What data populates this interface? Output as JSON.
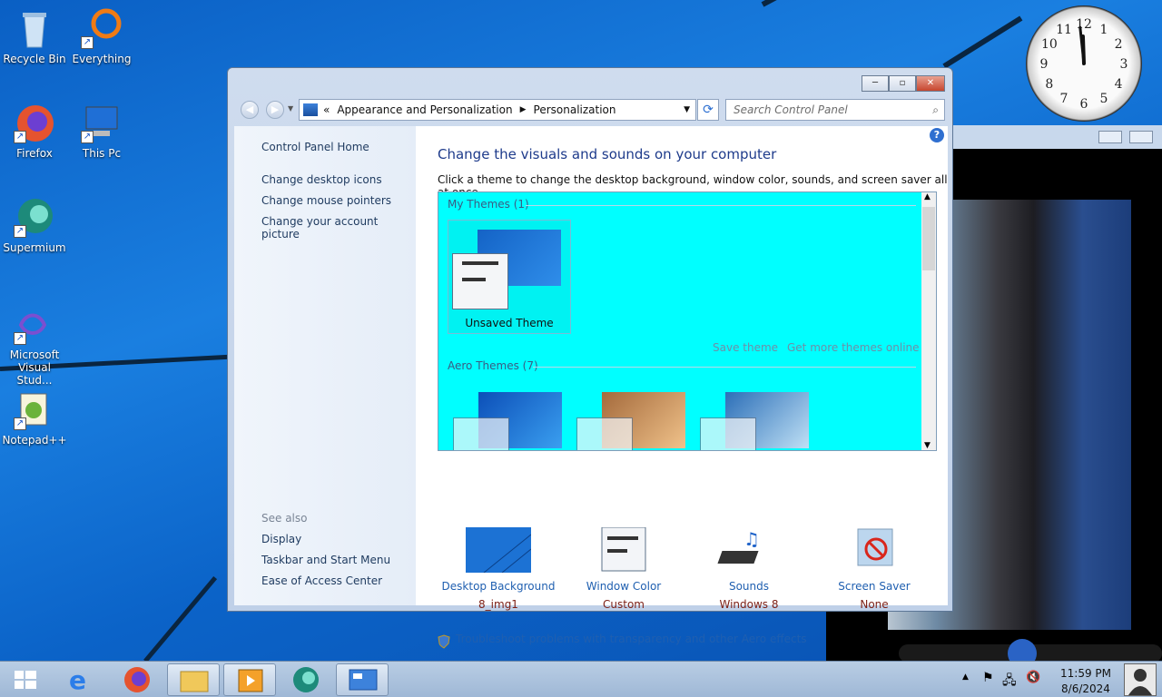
{
  "desktop": {
    "icons": [
      {
        "label": "Recycle Bin",
        "icon": "recycle-bin-icon"
      },
      {
        "label": "Everything",
        "icon": "everything-search-icon"
      },
      {
        "label": "Firefox",
        "icon": "firefox-icon"
      },
      {
        "label": "This Pc",
        "icon": "computer-icon"
      },
      {
        "label": "Supermium",
        "icon": "supermium-icon"
      },
      {
        "label": "Microsoft Visual Stud...",
        "icon": "visual-studio-icon"
      },
      {
        "label": "Notepad++",
        "icon": "notepad-plus-plus-icon"
      }
    ]
  },
  "clock": {
    "numbers": [
      "12",
      "1",
      "2",
      "3",
      "4",
      "5",
      "6",
      "7",
      "8",
      "9",
      "10",
      "11"
    ]
  },
  "window": {
    "address": {
      "root": "Appearance and Personalization",
      "current": "Personalization"
    },
    "search_placeholder": "Search Control Panel",
    "left_pane": {
      "home": "Control Panel Home",
      "links": [
        "Change desktop icons",
        "Change mouse pointers",
        "Change your account picture"
      ],
      "see_also": "See also",
      "see_also_links": [
        "Display",
        "Taskbar and Start Menu",
        "Ease of Access Center"
      ]
    },
    "title": "Change the visuals and sounds on your computer",
    "subtitle": "Click a theme to change the desktop background, window color, sounds, and screen saver all at once.",
    "themes": {
      "my_themes_header": "My Themes (1)",
      "unsaved_theme": "Unsaved Theme",
      "save_theme": "Save theme",
      "get_more": "Get more themes online",
      "aero_header": "Aero Themes (7)"
    },
    "settings": [
      {
        "label": "Desktop Background",
        "value": "8_img1"
      },
      {
        "label": "Window Color",
        "value": "Custom"
      },
      {
        "label": "Sounds",
        "value": "Windows 8"
      },
      {
        "label": "Screen Saver",
        "value": "None"
      }
    ],
    "troubleshoot": "Troubleshoot problems with transparency and other Aero effects"
  },
  "taskbar": {
    "time": "11:59 PM",
    "date": "8/6/2024"
  },
  "colors": {
    "theme_pane_bg": "#00ffff",
    "link": "#1f5fb0",
    "value": "#7d1f14"
  }
}
